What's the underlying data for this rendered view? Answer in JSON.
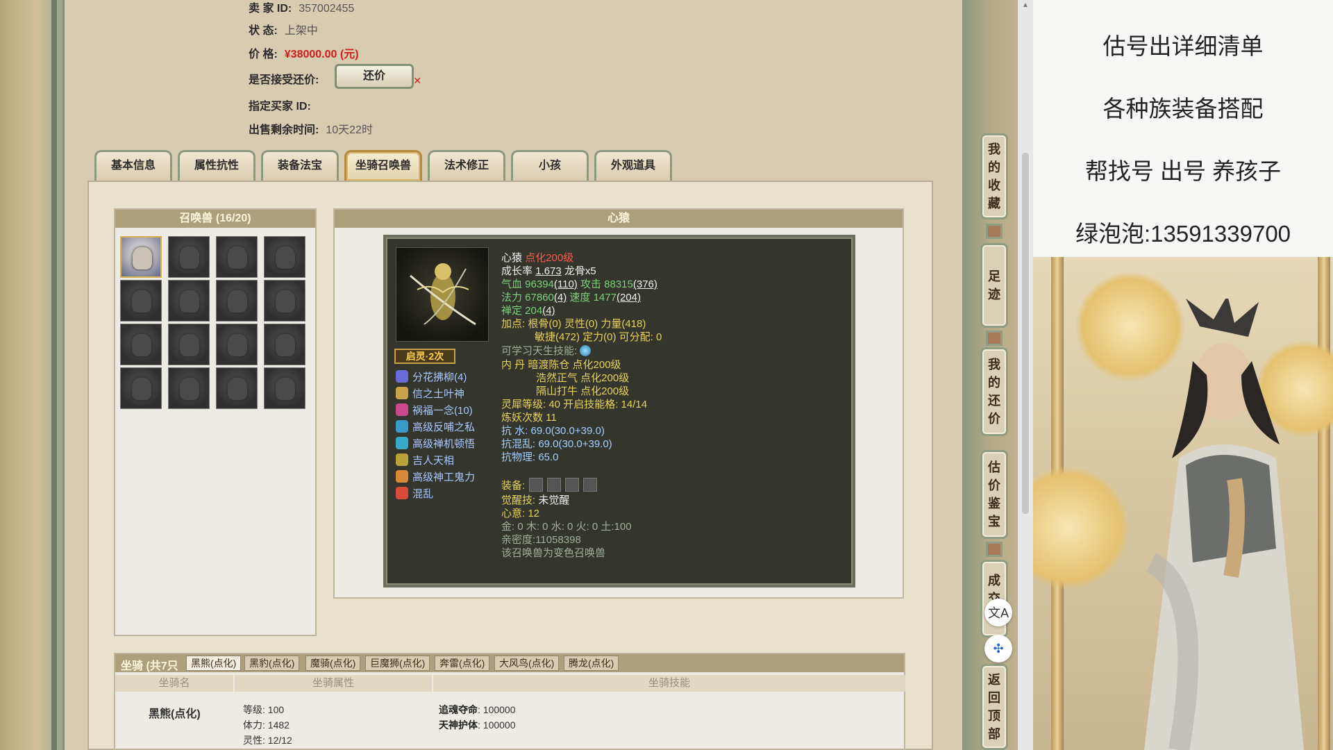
{
  "seller": {
    "label": "卖 家 ID:",
    "value": "357002455"
  },
  "status": {
    "label": "状 态:",
    "value": "上架中"
  },
  "price": {
    "label": "价 格:",
    "value": "¥38000.00 (元)"
  },
  "bargain": {
    "label": "是否接受还价:",
    "button": "还价"
  },
  "buyer_id": {
    "label": "指定买家 ID:",
    "value": ""
  },
  "remaining": {
    "label": "出售剩余时间:",
    "value": "10天22时"
  },
  "tabs": [
    "基本信息",
    "属性抗性",
    "装备法宝",
    "坐骑召唤兽",
    "法术修正",
    "小孩",
    "外观道具"
  ],
  "active_tab": "坐骑召唤兽",
  "summon_list": {
    "title": "召唤兽 (16/20)",
    "count": 16
  },
  "detail": {
    "title": "心猿",
    "tag": "启灵·2次",
    "skills": [
      "分花拂柳(4)",
      "信之土叶神",
      "祸福一念(10)",
      "高级反哺之私",
      "高级禅机顿悟",
      "吉人天相",
      "高级神工鬼力",
      "混乱"
    ],
    "name": "心猿",
    "name_suffix": "点化200级",
    "growth_label": "成长率",
    "growth": "1.673",
    "growth_extra": "龙骨x5",
    "hp": "气血 96394",
    "hp_add": "(110)",
    "atk": "攻击 88315",
    "atk_add": "(376)",
    "mp": "法力 67860",
    "mp_add": "(4)",
    "speed": "速度 1477",
    "speed_add": "(204)",
    "focus": "禅定 204",
    "focus_add": "(4)",
    "points1": "加点: 根骨(0) 灵性(0) 力量(418)",
    "points2": "敏捷(472) 定力(0) 可分配: 0",
    "learn": "可学习天生技能:",
    "inner1": "内 丹 暗渡陈仓 点化200级",
    "inner2": "浩然正气 点化200级",
    "inner3": "隔山打牛 点化200级",
    "spirit": "灵犀等级: 40 开启技能格: 14/14",
    "refine": "炼妖次数 11",
    "res_water": "抗 水: 69.0(30.0+39.0)",
    "res_chaos": "抗混乱: 69.0(30.0+39.0)",
    "res_phys": "抗物理: 65.0",
    "equip_label": "装备:",
    "awake_label": "觉醒技:",
    "awake_value": "未觉醒",
    "heart": "心意: 12",
    "elements": "金: 0 木: 0 水: 0 火: 0 土:100",
    "intimacy": "亲密度:11058398",
    "note": "该召唤兽为变色召唤兽"
  },
  "mounts": {
    "title": "坐骑 (共7只",
    "tabs": [
      "黑熊(点化)",
      "黑豹(点化)",
      "魔骑(点化)",
      "巨魔狮(点化)",
      "奔雷(点化)",
      "大风鸟(点化)",
      "腾龙(点化)"
    ],
    "col_name": "坐骑名",
    "col_attr": "坐骑属性",
    "col_skill": "坐骑技能",
    "name": "黑熊(点化)",
    "level": "等级: 100",
    "stamina": "体力: 1482",
    "spirit": "灵性: 12/12",
    "skill1_name": "追魂夺命",
    "skill1_val": ": 100000",
    "skill2_name": "天神护体",
    "skill2_val": ": 100000"
  },
  "sidebar": [
    "我的收藏",
    "足迹",
    "我的还价",
    "估价鉴宝",
    "成交询",
    "返回顶部"
  ],
  "promo": [
    "估号出详细清单",
    "各种族装备搭配",
    "帮找号 出号 养孩子",
    "绿泡泡:13591339700"
  ],
  "colors": {
    "price": "#d21c1c",
    "accent": "#ad9f7c",
    "dark_panel": "#34352c"
  }
}
